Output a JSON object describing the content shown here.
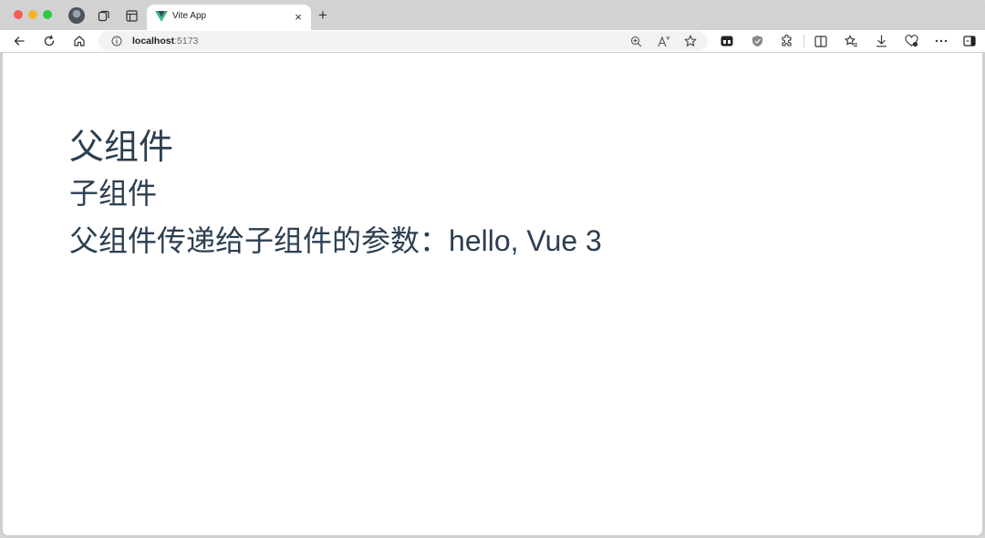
{
  "browser": {
    "tab": {
      "title": "Vite App",
      "close_glyph": "×"
    },
    "new_tab_glyph": "+",
    "address": {
      "host": "localhost",
      "port": ":5173"
    },
    "accent_vue_green": "#42b883",
    "accent_vue_dark": "#35495e"
  },
  "page": {
    "parent_title": "父组件",
    "child_title": "子组件",
    "message_label": "父组件传递给子组件的参数：",
    "message_value": "hello, Vue 3",
    "text_color": "#2c3e50"
  },
  "icons": [
    "profile-avatar-icon",
    "collections-icon",
    "tab-actions-icon",
    "vue-favicon-icon",
    "back-icon",
    "refresh-icon",
    "home-icon",
    "info-icon",
    "zoom-icon",
    "read-aloud-icon",
    "favorite-star-icon",
    "extension-tile-icon",
    "shield-extension-icon",
    "extensions-puzzle-icon",
    "split-screen-icon",
    "favorites-icon",
    "downloads-icon",
    "performance-icon",
    "more-icon",
    "sidebar-icon"
  ]
}
